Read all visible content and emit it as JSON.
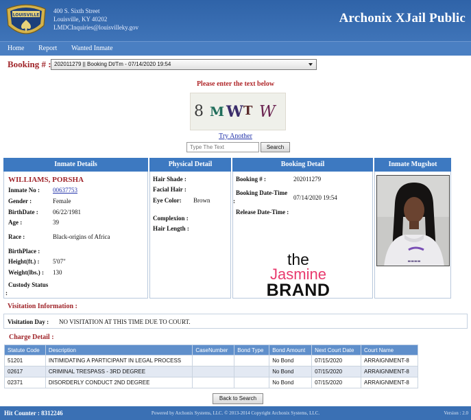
{
  "header": {
    "address_line1": "400 S. Sixth Street",
    "address_line2": "Louisville, KY 40202",
    "address_line3": "LMDCInquiries@louisvilleky.gov",
    "logo_text": "LOUISVILLE",
    "title": "Archonix XJail Public"
  },
  "nav": {
    "items": [
      "Home",
      "Report",
      "Wanted Inmate"
    ]
  },
  "booking": {
    "label": "Booking # :",
    "selected": "202011279 || Booking Dt/Tm - 07/14/2020 19:54"
  },
  "captcha": {
    "prompt": "Please enter the text below",
    "chars": [
      "8",
      "M",
      "W",
      "T",
      "W"
    ],
    "try_another": "Try Another",
    "placeholder": "Type The Text",
    "search_label": "Search"
  },
  "panels": {
    "inmate": {
      "header": "Inmate Details",
      "name": "WILLIAMS, PORSHA",
      "inmate_no_label": "Inmate No :",
      "inmate_no": "00637753",
      "gender_label": "Gender :",
      "gender": "Female",
      "birthdate_label": "BirthDate :",
      "birthdate": "06/22/1981",
      "age_label": "Age :",
      "age": "39",
      "race_label": "Race :",
      "race": "Black-origins of Africa",
      "birthplace_label": "BirthPlace :",
      "height_label": "Height(ft.) :",
      "height": "5'07\"",
      "weight_label": "Weight(lbs.) :",
      "weight": "130",
      "custody_label": "Custody Status",
      "custody_colon": ":"
    },
    "physical": {
      "header": "Physical Detail",
      "hair_shade_label": "Hair Shade :",
      "facial_hair_label": "Facial Hair :",
      "eye_color_label": "Eye Color:",
      "eye_color": "Brown",
      "complexion_label": "Complexion :",
      "hair_length_label": "Hair Length :"
    },
    "booking": {
      "header": "Booking Detail",
      "booking_no_label": "Booking # :",
      "booking_no": "202011279",
      "booking_dt_label": "Booking Date-Time",
      "booking_dt_colon": ":",
      "booking_dt": "07/14/2020 19:54",
      "release_dt_label": "Release Date-Time :"
    },
    "mugshot": {
      "header": "Inmate Mugshot"
    }
  },
  "watermark": {
    "line1": "the",
    "line2": "Jasmine",
    "line3": "BRAND"
  },
  "visitation": {
    "title": "Visitation Information :",
    "day_label": "Visitation Day :",
    "day_value": "NO VISITATION AT THIS TIME DUE TO COURT."
  },
  "charges": {
    "title": "Charge Detail :",
    "columns": [
      "Statute Code",
      "Description",
      "CaseNumber",
      "Bond Type",
      "Bond Amount",
      "Next Court Date",
      "Court Name"
    ],
    "rows": [
      [
        "51201",
        "INTIMIDATING A PARTICIPANT IN LEGAL PROCESS",
        "",
        "",
        "No Bond",
        "07/15/2020",
        "ARRAIGNMENT-8"
      ],
      [
        "02617",
        "CRIMINAL TRESPASS - 3RD DEGREE",
        "",
        "",
        "No Bond",
        "07/15/2020",
        "ARRAIGNMENT-8"
      ],
      [
        "02371",
        "DISORDERLY CONDUCT 2ND DEGREE",
        "",
        "",
        "No Bond",
        "07/15/2020",
        "ARRAIGNMENT-8"
      ]
    ]
  },
  "back_button": "Back to Search",
  "footer": {
    "hit_counter": "Hit Counter : 8312246",
    "powered": "Powered by Archonix Systems, LLC. © 2013-2014 Copyright Archonix Systems, LLC.",
    "version": "Version : 2.0"
  },
  "colors": {
    "header_blue": "#2f63a8",
    "nav_blue": "#4a7fc2",
    "panel_header_blue": "#3d79c1",
    "accent_red": "#a0252a",
    "watermark_pink": "#e83a6e"
  }
}
